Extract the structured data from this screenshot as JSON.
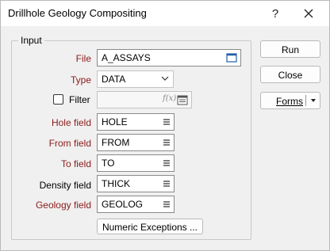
{
  "window": {
    "title": "Drillhole Geology Compositing",
    "help_label": "?",
    "close_label": "✕"
  },
  "input_group": {
    "label": "Input",
    "file": {
      "label": "File",
      "value": "A_ASSAYS"
    },
    "type": {
      "label": "Type",
      "value": "DATA"
    },
    "filter": {
      "label": "Filter",
      "value": "",
      "checked": false,
      "fx_label": "f(x)"
    },
    "hole_field": {
      "label": "Hole field",
      "value": "HOLE"
    },
    "from_field": {
      "label": "From field",
      "value": "FROM"
    },
    "to_field": {
      "label": "To field",
      "value": "TO"
    },
    "density_field": {
      "label": "Density field",
      "value": "THICK"
    },
    "geology_field": {
      "label": "Geology field",
      "value": "GEOLOG"
    },
    "numeric_exceptions_label": "Numeric Exceptions ..."
  },
  "buttons": {
    "run": "Run",
    "close": "Close",
    "forms": "Forms"
  },
  "colors": {
    "required_label": "#8b1a1a",
    "icon_blue": "#1f5fa8"
  }
}
